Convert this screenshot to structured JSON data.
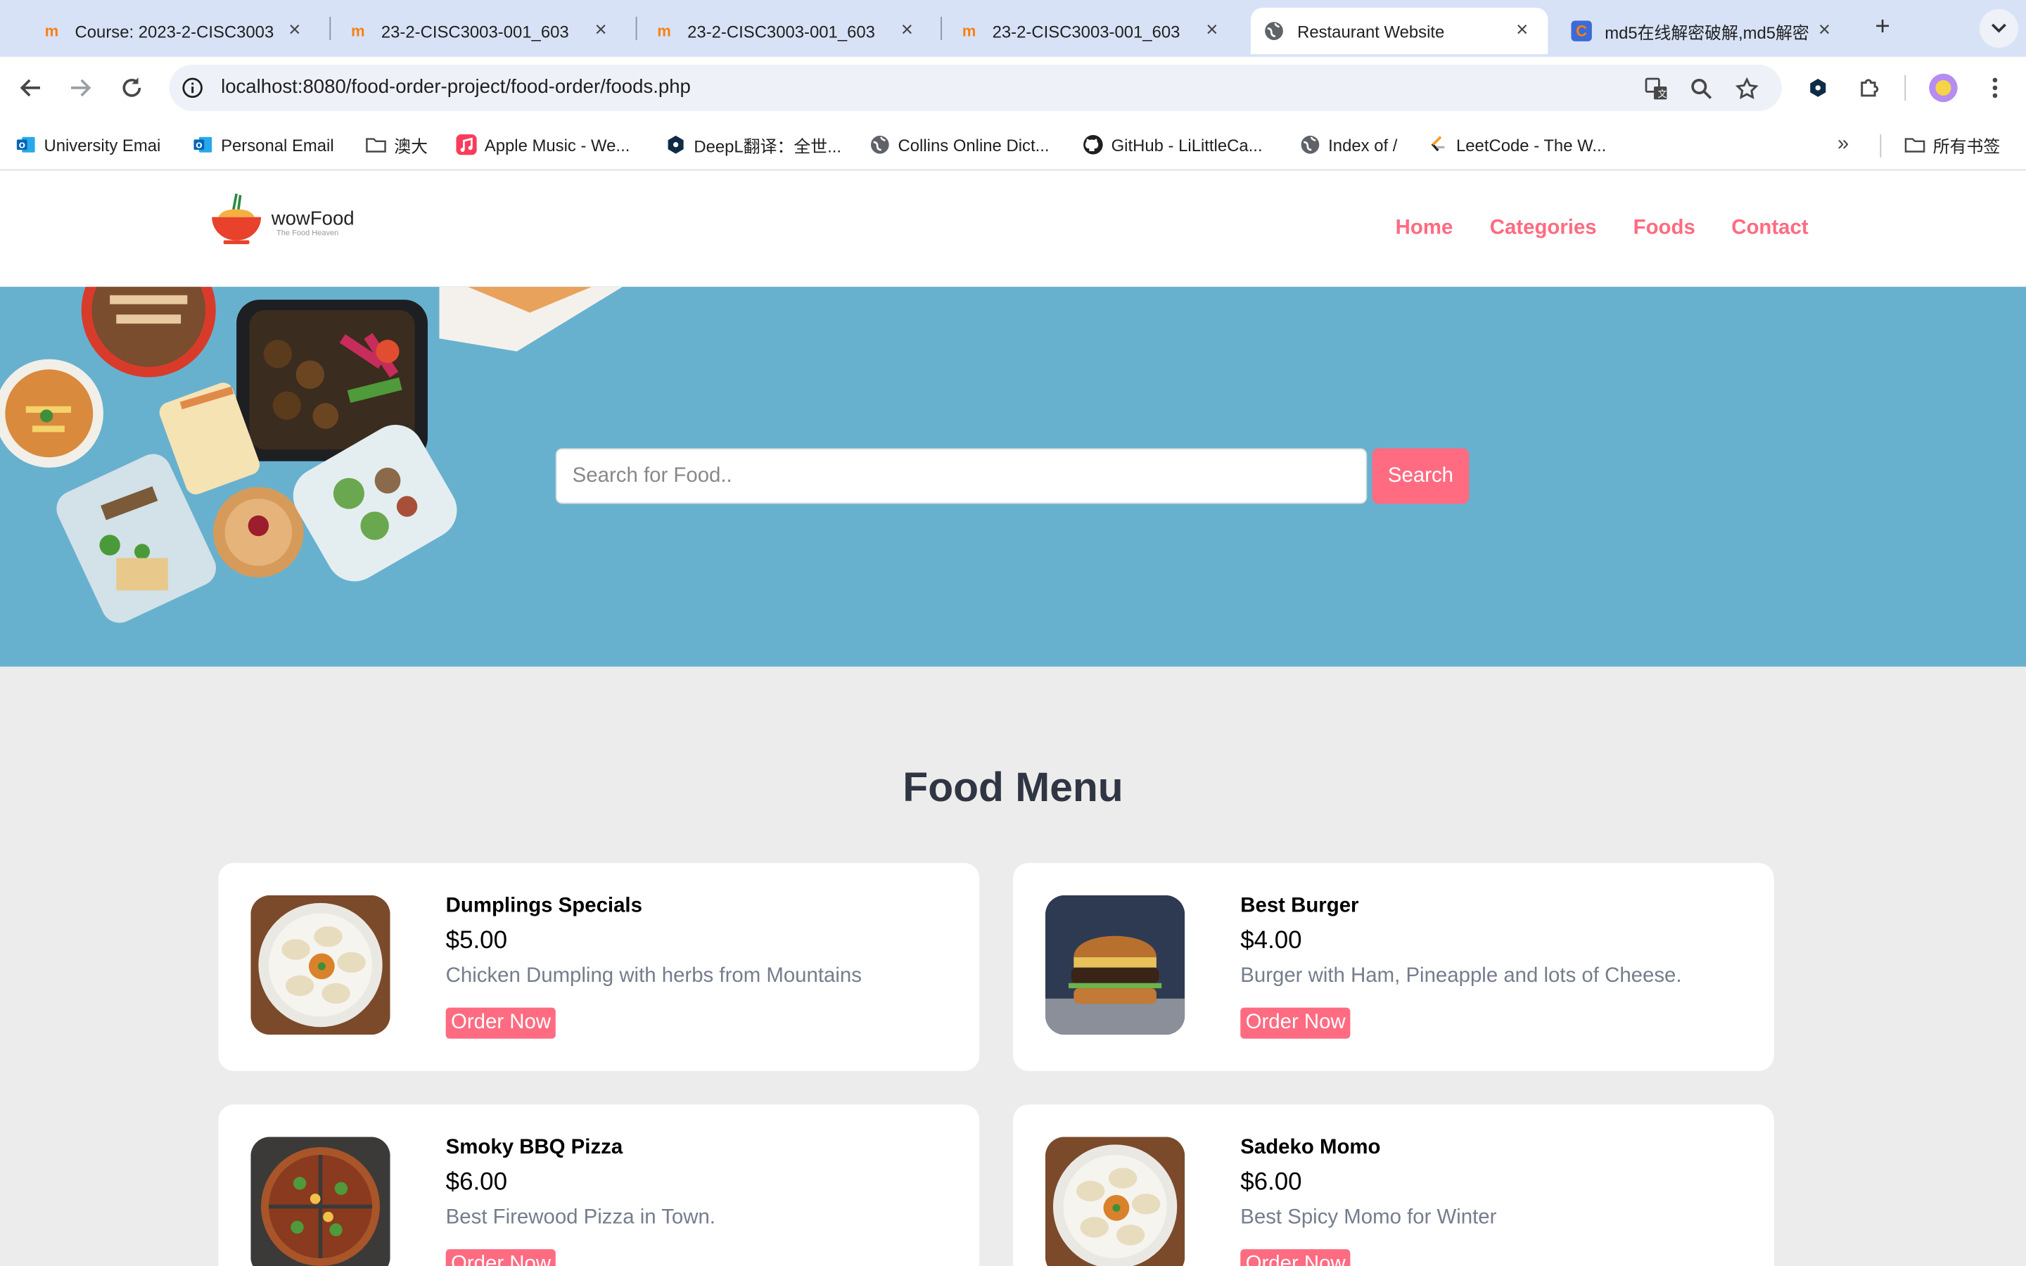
{
  "browser": {
    "tabs": [
      {
        "title": "Course: 2023-2-CISC3003",
        "icon": "moodle-icon"
      },
      {
        "title": "23-2-CISC3003-001_603",
        "icon": "moodle-icon"
      },
      {
        "title": "23-2-CISC3003-001_603",
        "icon": "moodle-icon"
      },
      {
        "title": "23-2-CISC3003-001_603",
        "icon": "moodle-icon"
      },
      {
        "title": "Restaurant Website",
        "icon": "globe-icon",
        "active": true
      },
      {
        "title": "md5在线解密破解,md5解密",
        "icon": "cmd5-icon"
      }
    ],
    "url": "localhost:8080/food-order-project/food-order/foods.php",
    "bookmarks": [
      {
        "label": "University Emai",
        "icon": "outlook-icon"
      },
      {
        "label": "Personal Email",
        "icon": "outlook-icon"
      },
      {
        "label": "澳大",
        "icon": "folder-icon"
      },
      {
        "label": "Apple Music - We...",
        "icon": "apple-music-icon"
      },
      {
        "label": "DeepL翻译：全世...",
        "icon": "deepl-icon"
      },
      {
        "label": "Collins Online Dict...",
        "icon": "globe-icon"
      },
      {
        "label": "GitHub - LiLittleCa...",
        "icon": "github-icon"
      },
      {
        "label": "Index of /",
        "icon": "globe-icon"
      },
      {
        "label": "LeetCode - The W...",
        "icon": "leetcode-icon"
      }
    ],
    "all_bookmarks": "所有书签"
  },
  "site": {
    "logo": {
      "brand": "wowFood",
      "tagline": "The Food Heaven"
    },
    "nav": [
      "Home",
      "Categories",
      "Foods",
      "Contact"
    ],
    "search": {
      "placeholder": "Search for Food..",
      "button": "Search"
    },
    "menu_title": "Food Menu",
    "foods": [
      {
        "name": "Dumplings Specials",
        "price": "$5.00",
        "description": "Chicken Dumpling with herbs from Mountains",
        "button": "Order Now"
      },
      {
        "name": "Best Burger",
        "price": "$4.00",
        "description": "Burger with Ham, Pineapple and lots of Cheese.",
        "button": "Order Now"
      },
      {
        "name": "Smoky BBQ Pizza",
        "price": "$6.00",
        "description": "Best Firewood Pizza in Town.",
        "button": "Order Now"
      },
      {
        "name": "Sadeko Momo",
        "price": "$6.00",
        "description": "Best Spicy Momo for Winter",
        "button": "Order Now"
      }
    ]
  },
  "colors": {
    "accent": "#ff6b81",
    "hero": "#67b1cf",
    "page_bg": "#ececec",
    "heading": "#2f3542",
    "desc": "#747d8c",
    "tabstrip": "#d8e2f6"
  }
}
